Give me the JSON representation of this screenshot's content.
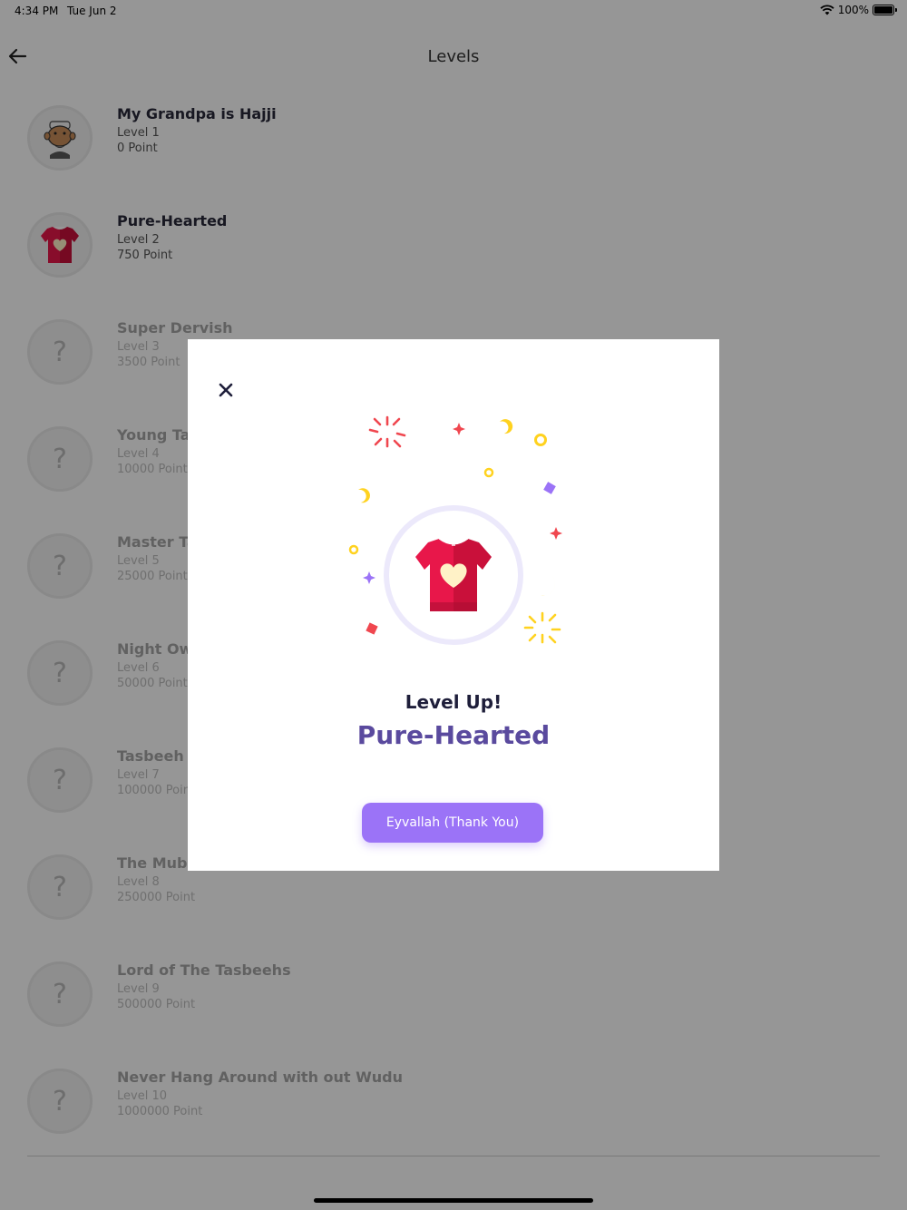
{
  "status_bar": {
    "time": "4:34 PM",
    "date": "Tue Jun 2",
    "battery": "100%",
    "wifi_icon": "wifi-icon",
    "battery_icon": "battery-icon",
    "battery_level": 1.0
  },
  "header": {
    "title": "Levels",
    "back_icon": "arrow-left-icon"
  },
  "levels": [
    {
      "name": "My Grandpa is Hajji",
      "level": "Level 1",
      "points": "0 Point",
      "unlocked": true,
      "icon": "grandpa-avatar-icon"
    },
    {
      "name": "Pure-Hearted",
      "level": "Level 2",
      "points": "750 Point",
      "unlocked": true,
      "icon": "heart-shirt-icon"
    },
    {
      "name": "Super Dervish",
      "level": "Level 3",
      "points": "3500 Point",
      "unlocked": false,
      "icon": "question-mark"
    },
    {
      "name": "Young Tas",
      "level": "Level 4",
      "points": "10000 Point",
      "unlocked": false,
      "icon": "question-mark"
    },
    {
      "name": "Master Tas",
      "level": "Level 5",
      "points": "25000 Point",
      "unlocked": false,
      "icon": "question-mark"
    },
    {
      "name": "Night Owl",
      "level": "Level 6",
      "points": "50000 Point",
      "unlocked": false,
      "icon": "question-mark"
    },
    {
      "name": "Tasbeeh L",
      "level": "Level 7",
      "points": "100000 Poin",
      "unlocked": false,
      "icon": "question-mark"
    },
    {
      "name": "The Mubar",
      "level": "Level 8",
      "points": "250000 Point",
      "unlocked": false,
      "icon": "question-mark"
    },
    {
      "name": "Lord of The Tasbeehs",
      "level": "Level 9",
      "points": "500000 Point",
      "unlocked": false,
      "icon": "question-mark"
    },
    {
      "name": "Never Hang Around with out Wudu",
      "level": "Level 10",
      "points": "1000000 Point",
      "unlocked": false,
      "icon": "question-mark"
    }
  ],
  "locked_symbol": "?",
  "modal": {
    "close_icon": "close-icon",
    "badge_icon": "heart-shirt-icon",
    "subtitle": "Level Up!",
    "title": "Pure-Hearted",
    "button_label": "Eyvallah (Thank You)"
  },
  "colors": {
    "accent": "#9b73f7",
    "title_purple": "#5a4a9e",
    "shirt_red": "#e8174a",
    "confetti_yellow": "#ffd21f"
  }
}
